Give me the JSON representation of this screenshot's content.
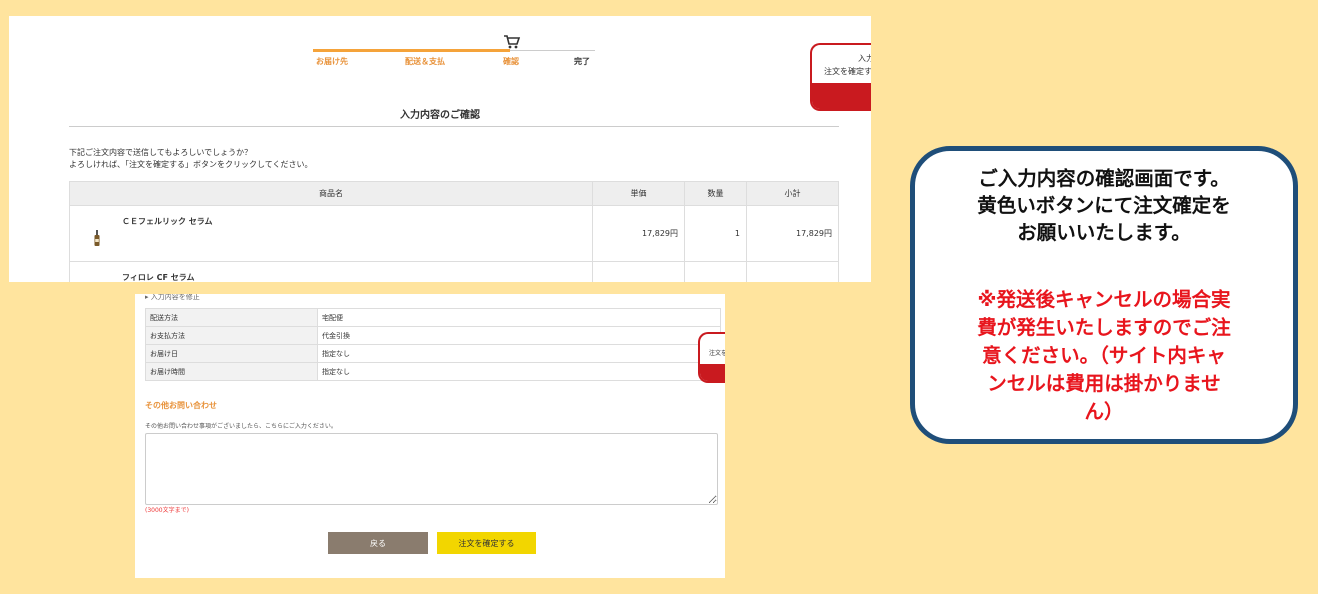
{
  "checkout_top": {
    "steps": [
      {
        "label": "お届け先"
      },
      {
        "label": "配送＆支払"
      },
      {
        "label": "確認"
      },
      {
        "label": "完了"
      }
    ],
    "side_tab": {
      "line1": "入力",
      "line2": "注文を確定す"
    },
    "page_title": "入力内容のご確認",
    "intro_line1": "下記ご注文内容で送信してもよろしいでしょうか？",
    "intro_line2": "よろしければ、「注文を確定する」ボタンをクリックしてください。",
    "table": {
      "headers": {
        "name": "商品名",
        "unit_price": "単価",
        "quantity": "数量",
        "subtotal": "小計"
      },
      "rows": [
        {
          "name": "ＣＥフェルリック セラム",
          "unit_price": "17,829円",
          "quantity": "1",
          "subtotal": "17,829円"
        },
        {
          "name": "フィロレ CF セラム",
          "unit_price": "",
          "quantity": "",
          "subtotal": ""
        }
      ]
    }
  },
  "checkout_bottom": {
    "modify_link": "▸ 入力内容を修正",
    "delivery_rows": [
      {
        "key": "配送方法",
        "value": "宅配便"
      },
      {
        "key": "お支払方法",
        "value": "代金引換"
      },
      {
        "key": "お届け日",
        "value": "指定なし"
      },
      {
        "key": "お届け時間",
        "value": "指定なし"
      }
    ],
    "side_tab": {
      "line1": "注文を"
    },
    "inquiry_title": "その他お問い合わせ",
    "inquiry_help": "その他お問い合わせ事項がございましたら、こちらにご入力ください。",
    "inquiry_value": "",
    "char_limit": "(3000文字まで)",
    "back_button": "戻る",
    "confirm_button": "注文を確定する"
  },
  "callout": {
    "message_lines": [
      "ご入力内容の確認画面です。",
      "黄色いボタンにて注文確定を",
      "お願いいたします。"
    ],
    "warning_lines": [
      "※発送後キャンセルの場合実",
      "費が発生いたしますのでご注",
      "意ください。（サイト内キャ",
      "ンセルは費用は掛かりませ",
      "ん）"
    ]
  },
  "colors": {
    "background": "#FFE49E",
    "accent_orange": "#F5A33A",
    "side_tab_red": "#C91A1F",
    "confirm_yellow": "#F2D600",
    "back_brown": "#8A7C6E",
    "callout_border": "#1F4E79",
    "warning_red": "#E8151D"
  },
  "icons": {
    "cart": "cart-icon",
    "bottle": "product-bottle-icon",
    "resize": "resize-handle-icon"
  }
}
